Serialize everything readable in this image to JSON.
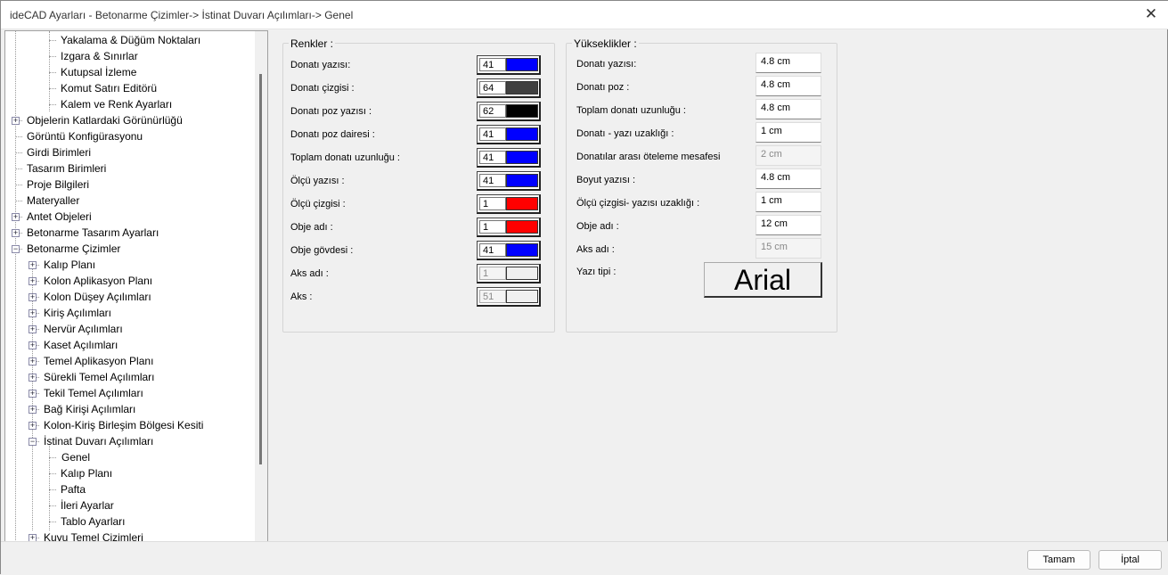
{
  "window": {
    "title": "ideCAD Ayarları - Betonarme Çizimler-> İstinat Duvarı Açılımları-> Genel",
    "close": "✕"
  },
  "tree": [
    {
      "label": "Yakalama & Düğüm Noktaları",
      "level": 2,
      "box": ""
    },
    {
      "label": "Izgara & Sınırlar",
      "level": 2,
      "box": ""
    },
    {
      "label": "Kutupsal İzleme",
      "level": 2,
      "box": ""
    },
    {
      "label": "Komut Satırı Editörü",
      "level": 2,
      "box": ""
    },
    {
      "label": "Kalem ve Renk Ayarları",
      "level": 2,
      "box": ""
    },
    {
      "label": "Objelerin Katlardaki Görünürlüğü",
      "level": 0,
      "box": "+"
    },
    {
      "label": "Görüntü Konfigürasyonu",
      "level": 0,
      "box": ""
    },
    {
      "label": "Girdi Birimleri",
      "level": 0,
      "box": ""
    },
    {
      "label": "Tasarım Birimleri",
      "level": 0,
      "box": ""
    },
    {
      "label": "Proje Bilgileri",
      "level": 0,
      "box": ""
    },
    {
      "label": "Materyaller",
      "level": 0,
      "box": ""
    },
    {
      "label": "Antet Objeleri",
      "level": 0,
      "box": "+"
    },
    {
      "label": "Betonarme Tasarım Ayarları",
      "level": 0,
      "box": "+"
    },
    {
      "label": "Betonarme Çizimler",
      "level": 0,
      "box": "−"
    },
    {
      "label": "Kalıp Planı",
      "level": 1,
      "box": "+"
    },
    {
      "label": "Kolon Aplikasyon Planı",
      "level": 1,
      "box": "+"
    },
    {
      "label": "Kolon Düşey Açılımları",
      "level": 1,
      "box": "+"
    },
    {
      "label": "Kiriş Açılımları",
      "level": 1,
      "box": "+"
    },
    {
      "label": "Nervür Açılımları",
      "level": 1,
      "box": "+"
    },
    {
      "label": "Kaset Açılımları",
      "level": 1,
      "box": "+"
    },
    {
      "label": "Temel Aplikasyon Planı",
      "level": 1,
      "box": "+"
    },
    {
      "label": "Sürekli Temel Açılımları",
      "level": 1,
      "box": "+"
    },
    {
      "label": "Tekil Temel Açılımları",
      "level": 1,
      "box": "+"
    },
    {
      "label": "Bağ Kirişi Açılımları",
      "level": 1,
      "box": "+"
    },
    {
      "label": "Kolon-Kiriş Birleşim Bölgesi Kesiti",
      "level": 1,
      "box": "+"
    },
    {
      "label": "İstinat Duvarı Açılımları",
      "level": 1,
      "box": "−"
    },
    {
      "label": "Genel",
      "level": 2,
      "box": "",
      "selected": true
    },
    {
      "label": "Kalıp Planı",
      "level": 2,
      "box": ""
    },
    {
      "label": "Pafta",
      "level": 2,
      "box": ""
    },
    {
      "label": "İleri Ayarlar",
      "level": 2,
      "box": ""
    },
    {
      "label": "Tablo Ayarları",
      "level": 2,
      "box": ""
    },
    {
      "label": "Kuyu Temel Çizimleri",
      "level": 1,
      "box": "+"
    }
  ],
  "colors": {
    "title": "Renkler :",
    "rows": [
      {
        "label": "Donatı yazısı:",
        "value": "41",
        "color": "#0000ff"
      },
      {
        "label": "Donatı çizgisi :",
        "value": "64",
        "color": "#404040"
      },
      {
        "label": "Donatı poz yazısı :",
        "value": "62",
        "color": "#000000"
      },
      {
        "label": "Donatı poz dairesi :",
        "value": "41",
        "color": "#0000ff"
      },
      {
        "label": "Toplam donatı uzunluğu :",
        "value": "41",
        "color": "#0000ff"
      },
      {
        "label": "Ölçü yazısı :",
        "value": "41",
        "color": "#0000ff"
      },
      {
        "label": "Ölçü çizgisi :",
        "value": "1",
        "color": "#ff0000"
      },
      {
        "label": "Obje adı :",
        "value": "1",
        "color": "#ff0000"
      },
      {
        "label": "Obje gövdesi :",
        "value": "41",
        "color": "#0000ff"
      },
      {
        "label": "Aks adı :",
        "value": "1",
        "color": "#f0f0f0",
        "disabled": true
      },
      {
        "label": "Aks :",
        "value": "51",
        "color": "#f0f0f0",
        "disabled": true
      }
    ]
  },
  "heights": {
    "title": "Yükseklikler :",
    "rows": [
      {
        "label": "Donatı yazısı:",
        "value": "4.8 cm"
      },
      {
        "label": "Donatı poz :",
        "value": "4.8 cm"
      },
      {
        "label": "Toplam donatı uzunluğu :",
        "value": "4.8 cm"
      },
      {
        "label": "Donatı - yazı uzaklığı :",
        "value": "1 cm"
      },
      {
        "label": "Donatılar arası öteleme mesafesi",
        "value": "2 cm",
        "disabled": true
      },
      {
        "label": "Boyut yazısı :",
        "value": "4.8 cm"
      },
      {
        "label": "Ölçü çizgisi- yazısı uzaklığı :",
        "value": "1 cm"
      },
      {
        "label": "Obje adı :",
        "value": "12 cm"
      },
      {
        "label": "Aks adı :",
        "value": "15 cm",
        "disabled": true
      }
    ],
    "font_label": "Yazı tipi :",
    "font_value": "Arial"
  },
  "footer": {
    "ok": "Tamam",
    "cancel": "İptal"
  }
}
